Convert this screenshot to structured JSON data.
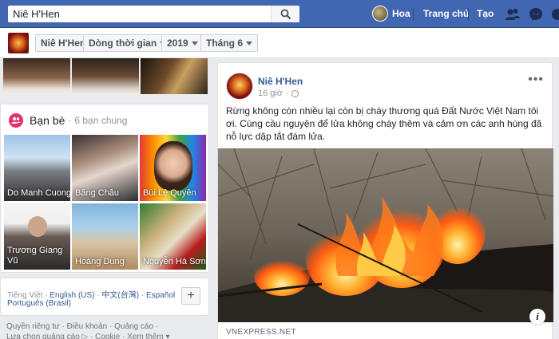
{
  "topbar": {
    "search_value": "Niê H'Hen",
    "user_name": "Hoa",
    "home_label": "Trang chủ",
    "create_label": "Tạo",
    "bg_color": "#4267b2"
  },
  "subbar": {
    "page_name": "Niê H'Hen",
    "timeline_label": "Dòng thời gian",
    "year": "2019",
    "month": "Tháng 6"
  },
  "friends": {
    "title": "Bạn bè",
    "subtitle": "6 bạn chung",
    "items": [
      {
        "name": "Do Manh Cuong"
      },
      {
        "name": "Băng Châu"
      },
      {
        "name": "Bùi Lệ Quyên"
      },
      {
        "name": "Trương Giang Vũ"
      },
      {
        "name": "Hoàng Dung"
      },
      {
        "name": "Nguyễn Hà Sơn"
      }
    ]
  },
  "languages": {
    "current": "Tiếng Việt",
    "options": [
      "English (US)",
      "中文(台灣)",
      "Español",
      "Português (Brasil)"
    ]
  },
  "footer": {
    "privacy": "Quyền riêng tư",
    "terms": "Điều khoản",
    "ads": "Quảng cáo",
    "ad_choices": "Lựa chọn quảng cáo",
    "cookie": "Cookie",
    "more": "Xem thêm"
  },
  "post": {
    "author": "Niê H'Hen",
    "time": "16 giờ",
    "text": "Rừng không còn nhiều lại còn bị cháy thương quá Đất Nước Việt Nam tôi ơi. Cùng cầu nguyện để lửa không cháy thêm và cảm ơn các anh hùng đã nỗ lực dập tắt đám lửa.",
    "link_source": "VNEXPRESS.NET",
    "more_label": "•••",
    "info_label": "i"
  }
}
